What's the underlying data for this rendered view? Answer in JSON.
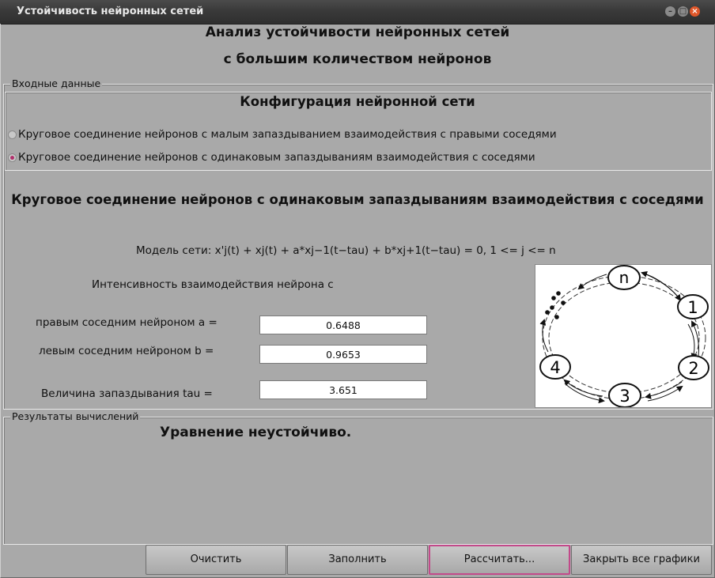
{
  "window": {
    "title": "Устойчивость нейронных сетей"
  },
  "header": {
    "line1": "Анализ устойчивости нейронных сетей",
    "line2": "с большим количеством нейронов"
  },
  "input_group": {
    "legend": "Входные данные",
    "config": {
      "title": "Конфигурация нейронной сети",
      "options": [
        {
          "label": "Круговое соединение нейронов с малым запаздыванием взаимодействия с правыми соседями",
          "selected": false
        },
        {
          "label": "Круговое соединение нейронов с одинаковым запаздываниям взаимодействия с соседями",
          "selected": true
        }
      ]
    },
    "selected_title": "Круговое соединение нейронов с одинаковым запаздываниям взаимодействия с соседями",
    "model": "Модель сети: x'j(t) + xj(t) + a*xj−1(t−tau) + b*xj+1(t−tau) = 0, 1 <= j <= n",
    "intensity_label": "Интенсивность взаимодействия нейрона с",
    "fields": {
      "a": {
        "label": "правым соседним нейроном a =",
        "value": "0.6488"
      },
      "b": {
        "label": "левым соседним нейроном b =",
        "value": "0.9653"
      },
      "tau": {
        "label": "Величина запаздывания tau =",
        "value": "3.651"
      }
    },
    "diagram": {
      "nodes": [
        "n",
        "1",
        "2",
        "3",
        "4"
      ]
    }
  },
  "results_group": {
    "legend": "Результаты вычислений",
    "result": "Уравнение неустойчиво."
  },
  "buttons": {
    "clear": "Очистить",
    "fill": "Заполнить",
    "compute": "Рассчитать...",
    "close_all": "Закрыть все графики"
  }
}
